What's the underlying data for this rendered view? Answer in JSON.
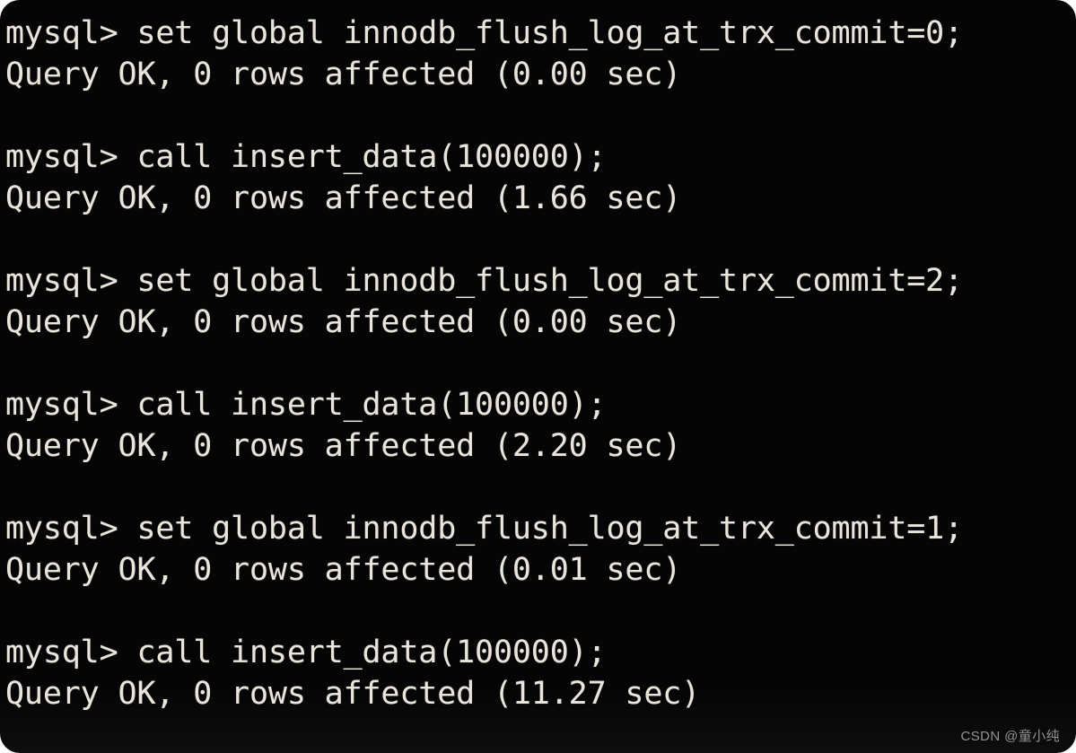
{
  "terminal": {
    "background_color": "#050505",
    "text_color": "#e9e5dd",
    "prompt": "mysql>",
    "lines": [
      {
        "type": "command",
        "text": "mysql> set global innodb_flush_log_at_trx_commit=0;"
      },
      {
        "type": "result",
        "text": "Query OK, 0 rows affected (0.00 sec)"
      },
      {
        "type": "blank",
        "text": ""
      },
      {
        "type": "command",
        "text": "mysql> call insert_data(100000);"
      },
      {
        "type": "result",
        "text": "Query OK, 0 rows affected (1.66 sec)"
      },
      {
        "type": "blank",
        "text": ""
      },
      {
        "type": "command",
        "text": "mysql> set global innodb_flush_log_at_trx_commit=2;"
      },
      {
        "type": "result",
        "text": "Query OK, 0 rows affected (0.00 sec)"
      },
      {
        "type": "blank",
        "text": ""
      },
      {
        "type": "command",
        "text": "mysql> call insert_data(100000);"
      },
      {
        "type": "result",
        "text": "Query OK, 0 rows affected (2.20 sec)"
      },
      {
        "type": "blank",
        "text": ""
      },
      {
        "type": "command",
        "text": "mysql> set global innodb_flush_log_at_trx_commit=1;"
      },
      {
        "type": "result",
        "text": "Query OK, 0 rows affected (0.01 sec)"
      },
      {
        "type": "blank",
        "text": ""
      },
      {
        "type": "command",
        "text": "mysql> call insert_data(100000);"
      },
      {
        "type": "result",
        "text": "Query OK, 0 rows affected (11.27 sec)"
      }
    ]
  },
  "watermark": {
    "text": "CSDN @童小纯",
    "color": "#9d9d9d"
  }
}
